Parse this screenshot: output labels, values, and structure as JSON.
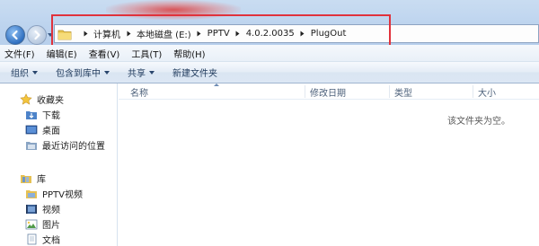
{
  "address": {
    "crumbs": [
      "计算机",
      "本地磁盘 (E:)",
      "PPTV",
      "4.0.2.0035",
      "PlugOut"
    ]
  },
  "menubar": {
    "items": [
      "文件(F)",
      "编辑(E)",
      "查看(V)",
      "工具(T)",
      "帮助(H)"
    ]
  },
  "toolbar": {
    "organize": "组织",
    "include_in_library": "包含到库中",
    "share": "共享",
    "new_folder": "新建文件夹"
  },
  "navpane": {
    "favorites": "收藏夹",
    "downloads": "下载",
    "desktop": "桌面",
    "recent": "最近访问的位置",
    "libraries": "库",
    "pptv_video": "PPTV视频",
    "videos": "视频",
    "pictures": "图片",
    "documents": "文档"
  },
  "columns": {
    "name": "名称",
    "modified": "修改日期",
    "type": "类型",
    "size": "大小"
  },
  "content": {
    "empty_message": "该文件夹为空。"
  },
  "colors": {
    "highlight_box": "#e0323c",
    "titlebar": "#c3d8f0"
  }
}
